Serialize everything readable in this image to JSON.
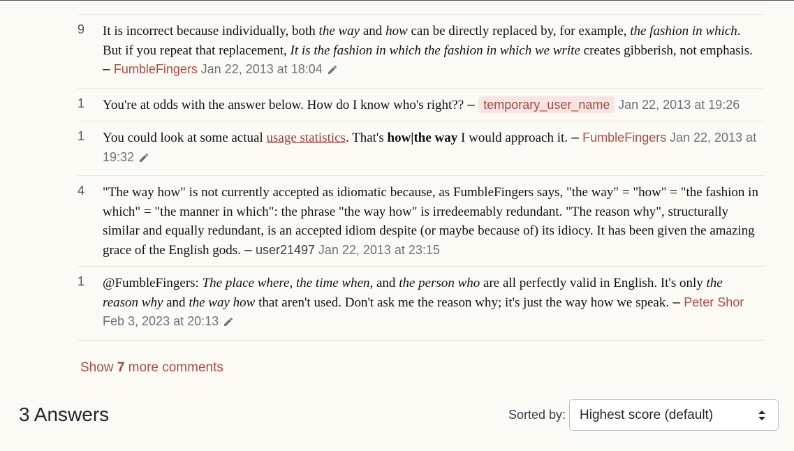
{
  "comments": [
    {
      "score": "9",
      "parts": {
        "t1": "It is incorrect because individually, both ",
        "i1": "the way",
        "t2": " and ",
        "i2": "how",
        "t3": " can be directly replaced by, for example, ",
        "i3": "the fashion in which",
        "t4": ". But if you repeat that replacement, ",
        "i4": "It is the fashion in which the fashion in which we write",
        "t5": " creates gibberish, not emphasis."
      },
      "author": "FumbleFingers",
      "date": "Jan 22, 2013 at 18:04"
    },
    {
      "score": "1",
      "text": "You're at odds with the answer below. How do I know who's right??",
      "author": "temporary_user_name",
      "date": "Jan 22, 2013 at 19:26"
    },
    {
      "score": "1",
      "parts": {
        "t1": "You could look at some actual ",
        "link": "usage statistics",
        "t2": ". That's ",
        "b1": "how|the way",
        "t3": " I would approach it."
      },
      "author": "FumbleFingers",
      "date": "Jan 22, 2013 at 19:32"
    },
    {
      "score": "4",
      "text": "\"The way how\" is not currently accepted as idiomatic because, as FumbleFingers says, \"the way\" = \"how\" = \"the fashion in which\" = \"the manner in which\": the phrase \"the way how\" is irredeemably redundant. \"The reason why\", structurally similar and equally redundant, is an accepted idiom despite (or maybe because of) its idiocy. It has been given the amazing grace of the English gods.",
      "author": "user21497",
      "date": "Jan 22, 2013 at 23:15"
    },
    {
      "score": "1",
      "parts": {
        "t1": "@FumbleFingers: ",
        "i1": "The place where, the time when,",
        "t2": " and ",
        "i2": "the person who",
        "t3": " are all perfectly valid in English. It's only ",
        "i3": "the reason why",
        "t4": " and ",
        "i4": "the way how",
        "t5": " that aren't used. Don't ask me the reason why; it's just the way how we speak."
      },
      "author": "Peter Shor",
      "date": "Feb 3, 2023 at 20:13"
    }
  ],
  "dash": " – ",
  "show_more": {
    "prefix": "Show ",
    "count": "7",
    "suffix": " more comments"
  },
  "answers": {
    "title": "3 Answers",
    "sorted_label": "Sorted by:",
    "sort_value": "Highest score (default)"
  },
  "icons": {
    "edit": "pencil-icon",
    "sort": "updown-arrows-icon"
  },
  "colors": {
    "user_link": "#b04a46",
    "op_badge_bg": "#f7e4e3",
    "background": "#fcfaf5"
  }
}
